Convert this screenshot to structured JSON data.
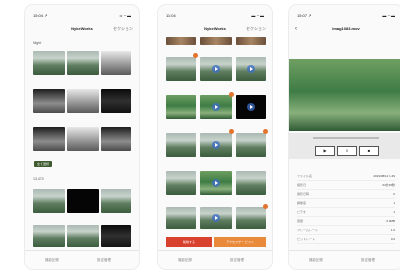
{
  "screens": [
    {
      "status": {
        "time": "15:04 ↗",
        "signal": "•• ◔ ▬"
      },
      "nav": {
        "title": "NykeWorks",
        "action": "セクション"
      },
      "sections": [
        {
          "label": "Night"
        },
        {
          "label": "13,470"
        }
      ],
      "toggle_label": "全て選択",
      "tabs": [
        "撮影記録",
        "設定管理"
      ]
    },
    {
      "status": {
        "time": "11:04",
        "signal": "▬ ◔ ▬"
      },
      "nav": {
        "title": "NykeWorks",
        "action": "セクション"
      },
      "buttons": {
        "delete": "削除する",
        "save": "アクセスサー ビスへ"
      },
      "tabs": [
        "撮影記録",
        "設定管理"
      ]
    },
    {
      "status": {
        "time": "15:07 ↗",
        "signal": "▬ ◔ ▬"
      },
      "nav": {
        "title": "Imag1083.mov"
      },
      "controls": {
        "play": "▶",
        "pause": "‖",
        "stop": "■"
      },
      "info_rows": [
        {
          "key": "ファイル名",
          "value": "2019/08/12 1.49"
        },
        {
          "key": "撮影日",
          "value": "04分26秒"
        },
        {
          "key": "撮影日時",
          "value": "0"
        },
        {
          "key": "解像度",
          "value": "1"
        },
        {
          "key": "ビデオ",
          "value": "1"
        },
        {
          "key": "容量",
          "value": "0.0MB"
        },
        {
          "key": "フレームレート",
          "value": "1.0"
        },
        {
          "key": "ビットレート",
          "value": "0.0"
        }
      ],
      "tabs": [
        "撮影記録",
        "設定管理"
      ]
    }
  ],
  "accent_colors": {
    "orange_badge": "#e3742d",
    "red_button": "#d9412f",
    "orange_button": "#e98a3b",
    "play_blue": "#3c6ec8",
    "pill_green": "#3f5b2f"
  }
}
